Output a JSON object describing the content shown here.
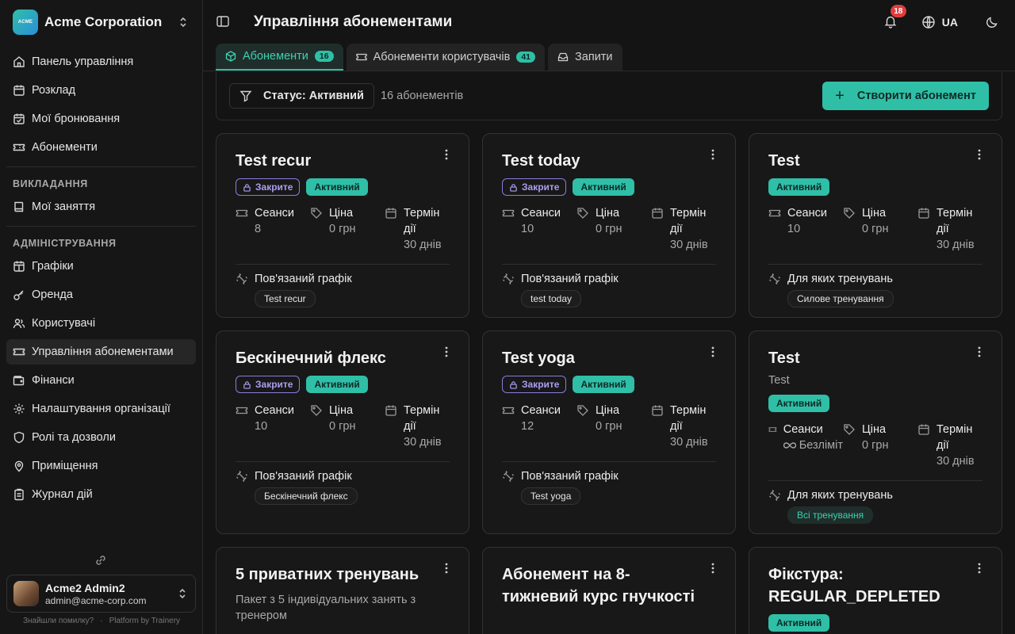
{
  "org": {
    "logo_text": "ACME",
    "name": "Acme Corporation"
  },
  "nav": {
    "main": [
      {
        "label": "Панель управління",
        "icon": "house-icon"
      },
      {
        "label": "Розклад",
        "icon": "calendar-icon"
      },
      {
        "label": "Мої бронювання",
        "icon": "calendar-check-icon"
      },
      {
        "label": "Абонементи",
        "icon": "ticket-icon"
      }
    ],
    "teaching_title": "ВИКЛАДАННЯ",
    "teaching": [
      {
        "label": "Мої заняття",
        "icon": "book-icon"
      }
    ],
    "admin_title": "АДМІНІСТРУВАННЯ",
    "admin": [
      {
        "label": "Графіки",
        "icon": "calendar-grid-icon"
      },
      {
        "label": "Оренда",
        "icon": "key-icon"
      },
      {
        "label": "Користувачі",
        "icon": "users-icon"
      },
      {
        "label": "Управління абонементами",
        "icon": "ticket-manage-icon",
        "active": true
      },
      {
        "label": "Фінанси",
        "icon": "wallet-icon"
      },
      {
        "label": "Налаштування організації",
        "icon": "settings-icon"
      },
      {
        "label": "Ролі та дозволи",
        "icon": "shield-icon"
      },
      {
        "label": "Приміщення",
        "icon": "map-pin-icon"
      },
      {
        "label": "Журнал дій",
        "icon": "clipboard-icon"
      }
    ]
  },
  "user": {
    "name": "Acme2 Admin2",
    "email": "admin@acme-corp.com"
  },
  "footer": {
    "report": "Знайшли помилку?",
    "platform": "Platform by Trainery"
  },
  "header": {
    "title": "Управління абонементами",
    "notifications": "18",
    "language": "UA"
  },
  "tabs": [
    {
      "label": "Абонементи",
      "count": "16",
      "active": true
    },
    {
      "label": "Абонементи користувачів",
      "count": "41"
    },
    {
      "label": "Запити"
    }
  ],
  "toolbar": {
    "filter_label": "Статус: Активний",
    "count_text": "16 абонементів",
    "create_label": "Створити абонемент"
  },
  "labels": {
    "closed": "Закрите",
    "active": "Активний",
    "sessions": "Сеанси",
    "price": "Ціна",
    "term_line1": "Термін",
    "term_line2": "дії",
    "linked_schedule": "Пов'язаний графік",
    "for_trainings": "Для яких тренувань",
    "unlimited": "Безліміт"
  },
  "cards": [
    {
      "title": "Test recur",
      "closed": true,
      "sessions": "8",
      "price": "0 грн",
      "term": "30 днів",
      "link_type": "schedule",
      "chip": "Test recur"
    },
    {
      "title": "Test today",
      "closed": true,
      "sessions": "10",
      "price": "0 грн",
      "term": "30 днів",
      "link_type": "schedule",
      "chip": "test today"
    },
    {
      "title": "Test",
      "closed": false,
      "sessions": "10",
      "price": "0 грн",
      "term": "30 днів",
      "link_type": "trainings",
      "chip": "Силове тренування"
    },
    {
      "title": "Бескінечний флекс",
      "closed": true,
      "sessions": "10",
      "price": "0 грн",
      "term": "30 днів",
      "link_type": "schedule",
      "chip": "Бескінечний флекс"
    },
    {
      "title": "Test yoga",
      "closed": true,
      "sessions": "12",
      "price": "0 грн",
      "term": "30 днів",
      "link_type": "schedule",
      "chip": "Test yoga"
    },
    {
      "title": "Test",
      "subtitle": "Test",
      "closed": false,
      "unlimited": true,
      "price": "0 грн",
      "term": "30 днів",
      "link_type": "trainings",
      "chip": "Всі тренування",
      "chip_accent": true
    },
    {
      "title": "5 приватних тренувань",
      "subtitle": "Пакет з 5 індивідуальних занять з тренером"
    },
    {
      "title": "Абонемент на 8-тижневий курс гнучкості"
    },
    {
      "title": "Фікстура: REGULAR_DEPLETED",
      "active_badge": true
    }
  ]
}
